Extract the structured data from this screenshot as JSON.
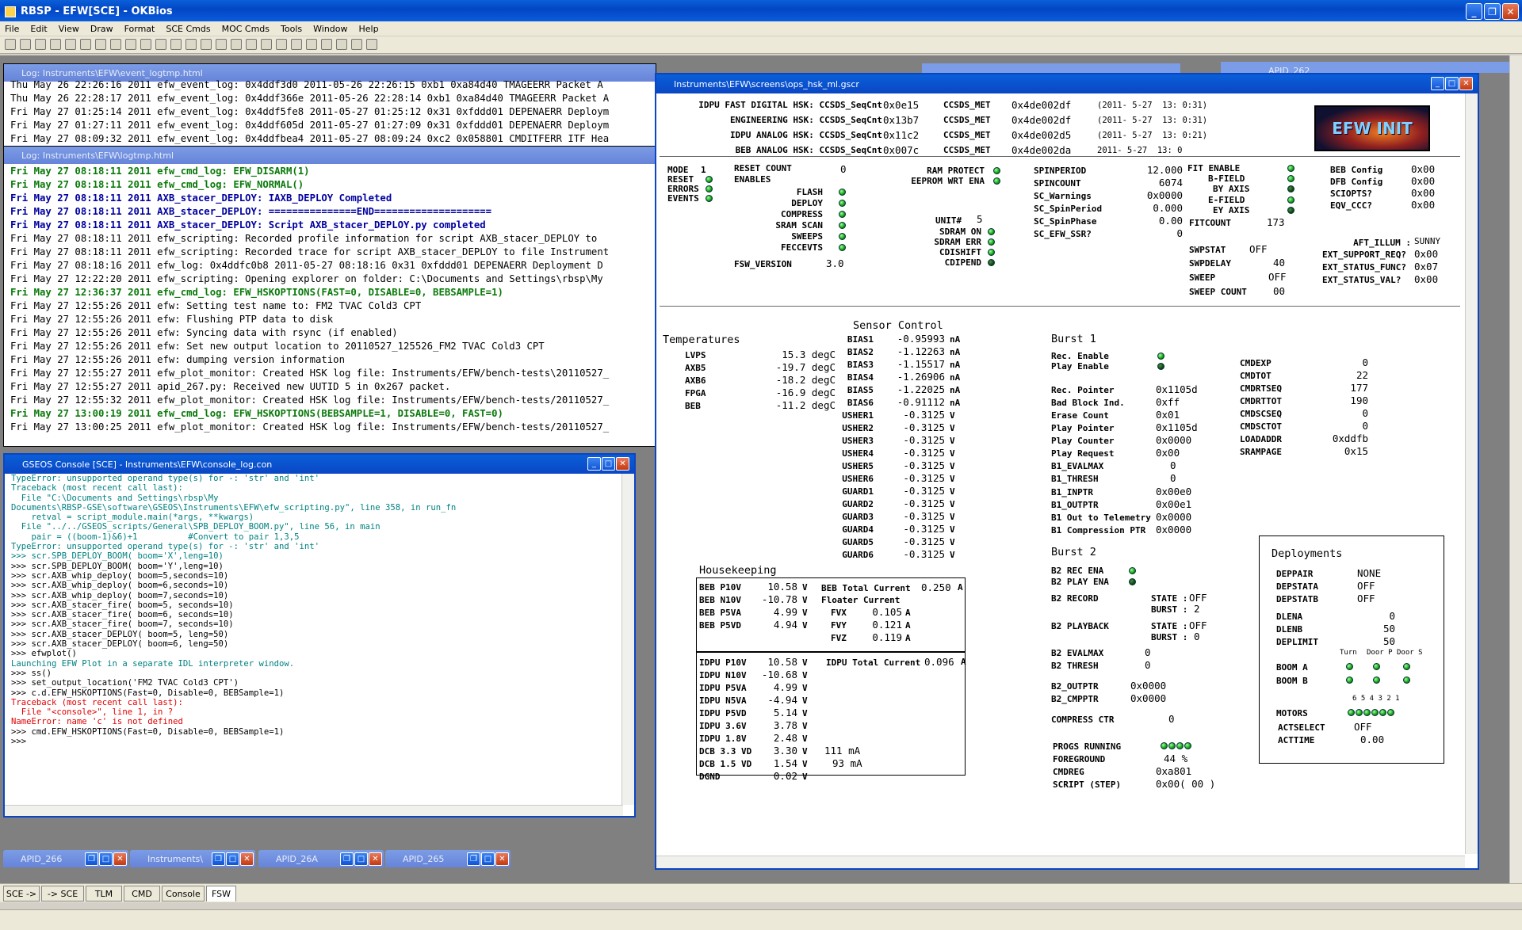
{
  "app": {
    "title": "RBSP - EFW[SCE] - OKBios",
    "menu": [
      "File",
      "Edit",
      "View",
      "Draw",
      "Format",
      "SCE Cmds",
      "MOC Cmds",
      "Tools",
      "Window",
      "Help"
    ]
  },
  "event_log": {
    "title": "Log: Instruments\\EFW\\event_logtmp.html",
    "lines": [
      "Thu May 26 22:26:16 2011 efw_event_log: 0x4ddf3d0 2011-05-26 22:26:15 0xb1 0xa84d40 TMAGEERR Packet A",
      "Thu May 26 22:28:17 2011 efw_event_log: 0x4ddf366e 2011-05-26 22:28:14 0xb1 0xa84d40 TMAGEERR Packet A",
      "Fri May 27 01:25:14 2011 efw_event_log: 0x4ddf5fe8 2011-05-27 01:25:12 0x31 0xfddd01 DEPENAERR Deploym",
      "Fri May 27 01:27:11 2011 efw_event_log: 0x4ddf605d 2011-05-27 01:27:09 0x31 0xfddd01 DEPENAERR Deploym",
      "Fri May 27 08:09:32 2011 efw_event_log: 0x4ddfbea4 2011-05-27 08:09:24 0xc2 0x058801 CMDITFERR ITF Hea"
    ]
  },
  "log": {
    "title": "Log: Instruments\\EFW\\logtmp.html",
    "lines": [
      {
        "t": "Fri May 27 08:18:11 2011 efw_cmd_log: EFW_DISARM(1)",
        "c": "g"
      },
      {
        "t": "Fri May 27 08:18:11 2011 efw_cmd_log: EFW_NORMAL()",
        "c": "g"
      },
      {
        "t": "Fri May 27 08:18:11 2011 AXB_stacer_DEPLOY: IAXB_DEPLOY Completed",
        "c": "b"
      },
      {
        "t": "Fri May 27 08:18:11 2011 AXB_stacer_DEPLOY: ===============END====================",
        "c": "b"
      },
      {
        "t": "Fri May 27 08:18:11 2011 AXB_stacer_DEPLOY: Script AXB_stacer_DEPLOY.py completed",
        "c": "b"
      },
      {
        "t": "Fri May 27 08:18:11 2011 efw_scripting: Recorded profile information for script AXB_stacer_DEPLOY to",
        "c": ""
      },
      {
        "t": "Fri May 27 08:18:11 2011 efw_scripting: Recorded trace for script AXB_stacer_DEPLOY to file Instrument",
        "c": ""
      },
      {
        "t": "Fri May 27 08:18:16 2011 efw_log: 0x4ddfc0b8 2011-05-27 08:18:16 0x31 0xfddd01 DEPENAERR Deployment D",
        "c": ""
      },
      {
        "t": "Fri May 27 12:22:20 2011 efw_scripting: Opening explorer on folder: C:\\Documents and Settings\\rbsp\\My",
        "c": ""
      },
      {
        "t": "Fri May 27 12:36:37 2011 efw_cmd_log: EFW_HSKOPTIONS(FAST=0, DISABLE=0, BEBSAMPLE=1)",
        "c": "g"
      },
      {
        "t": "Fri May 27 12:55:26 2011 efw: Setting test name to: FM2 TVAC Cold3 CPT",
        "c": ""
      },
      {
        "t": "Fri May 27 12:55:26 2011 efw: Flushing PTP data to disk",
        "c": ""
      },
      {
        "t": "Fri May 27 12:55:26 2011 efw: Syncing data with rsync (if enabled)",
        "c": ""
      },
      {
        "t": "Fri May 27 12:55:26 2011 efw: Set new output location to 20110527_125526_FM2 TVAC Cold3 CPT",
        "c": ""
      },
      {
        "t": "Fri May 27 12:55:26 2011 efw: dumping version information",
        "c": ""
      },
      {
        "t": "Fri May 27 12:55:27 2011 efw_plot_monitor: Created HSK log file: Instruments/EFW/bench-tests\\20110527_",
        "c": ""
      },
      {
        "t": "Fri May 27 12:55:27 2011 apid_267.py: Received new UUTID 5 in 0x267 packet.",
        "c": ""
      },
      {
        "t": "Fri May 27 12:55:32 2011 efw_plot_monitor: Created HSK log file: Instruments/EFW/bench-tests/20110527_",
        "c": ""
      },
      {
        "t": "Fri May 27 13:00:19 2011 efw_cmd_log: EFW_HSKOPTIONS(BEBSAMPLE=1, DISABLE=0, FAST=0)",
        "c": "g"
      },
      {
        "t": "Fri May 27 13:00:25 2011 efw_plot_monitor: Created HSK log file: Instruments/EFW/bench-tests/20110527_",
        "c": ""
      }
    ]
  },
  "console": {
    "title": "GSEOS Console  [SCE] - Instruments\\EFW\\console_log.con",
    "lines": [
      {
        "t": "TypeError: unsupported operand type(s) for -: 'str' and 'int'",
        "c": "teal"
      },
      {
        "t": "Traceback (most recent call last):",
        "c": "teal"
      },
      {
        "t": "  File \"C:\\Documents and Settings\\rbsp\\My",
        "c": "teal"
      },
      {
        "t": "Documents\\RBSP-GSE\\software\\GSEOS\\Instruments\\EFW\\efw_scripting.py\", line 358, in run_fn",
        "c": "teal"
      },
      {
        "t": "    retval = script_module.main(*args, **kwargs)",
        "c": "teal"
      },
      {
        "t": "  File \"../../GSEOS_scripts/General\\SPB_DEPLOY_BOOM.py\", line 56, in main",
        "c": "teal"
      },
      {
        "t": "    pair = ((boom-1)&6)+1          #Convert to pair 1,3,5",
        "c": "teal"
      },
      {
        "t": "TypeError: unsupported operand type(s) for -: 'str' and 'int'",
        "c": "teal"
      },
      {
        "t": ">>> scr.SPB_DEPLOY_BOOM( boom='X',leng=10)",
        "c": "teal"
      },
      {
        "t": ">>> scr.SPB_DEPLOY_BOOM( boom='Y',leng=10)",
        "c": ""
      },
      {
        "t": ">>> scr.AXB_whip_deploy( boom=5,seconds=10)",
        "c": ""
      },
      {
        "t": ">>> scr.AXB_whip_deploy( boom=6,seconds=10)",
        "c": ""
      },
      {
        "t": ">>> scr.AXB_whip_deploy( boom=7,seconds=10)",
        "c": ""
      },
      {
        "t": ">>> scr.AXB_stacer_fire( boom=5, seconds=10)",
        "c": ""
      },
      {
        "t": ">>> scr.AXB_stacer_fire( boom=6, seconds=10)",
        "c": ""
      },
      {
        "t": ">>> scr.AXB_stacer_fire( boom=7, seconds=10)",
        "c": ""
      },
      {
        "t": ">>> scr.AXB_stacer_DEPLOY( boom=5, leng=50)",
        "c": ""
      },
      {
        "t": ">>> scr.AXB_stacer_DEPLOY( boom=6, leng=50)",
        "c": ""
      },
      {
        "t": ">>> efwplot()",
        "c": ""
      },
      {
        "t": "Launching EFW Plot in a separate IDL interpreter window.",
        "c": "teal"
      },
      {
        "t": ">>> ss()",
        "c": ""
      },
      {
        "t": ">>> set_output_location('FM2 TVAC Cold3 CPT')",
        "c": ""
      },
      {
        "t": ">>> c.d.EFW_HSKOPTIONS(Fast=0, Disable=0, BEBSample=1)",
        "c": ""
      },
      {
        "t": "Traceback (most recent call last):",
        "c": "red"
      },
      {
        "t": "  File \"<console>\", line 1, in ?",
        "c": "red"
      },
      {
        "t": "NameError: name 'c' is not defined",
        "c": "red"
      },
      {
        "t": ">>> cmd.EFW_HSKOPTIONS(Fast=0, Disable=0, BEBSample=1)",
        "c": ""
      },
      {
        "t": ">>>",
        "c": ""
      }
    ]
  },
  "bg_window": {
    "title": "APID_262"
  },
  "taskbar_windows": [
    "APID_266",
    "Instruments\\",
    "APID_26A",
    "APID_265"
  ],
  "bottom_tabs": [
    "SCE ->",
    "-> SCE",
    "TLM",
    "CMD",
    "Console",
    "FSW"
  ],
  "hsk": {
    "title": "Instruments\\EFW\\screens\\ops_hsk_ml.gscr",
    "logo": "EFW INIT",
    "header": [
      {
        "l": "IDPU FAST DIGITAL HSK: CCSDS_SeqCnt",
        "seq": "0x0e15",
        "met": "0x4de002df",
        "ts": "(2011- 5-27  13: 0:31)"
      },
      {
        "l": "ENGINEERING HSK: CCSDS_SeqCnt",
        "seq": "0x13b7",
        "met": "0x4de002df",
        "ts": "(2011- 5-27  13: 0:31)"
      },
      {
        "l": "IDPU ANALOG HSK: CCSDS_SeqCnt",
        "seq": "0x11c2",
        "met": "0x4de002d5",
        "ts": "(2011- 5-27  13: 0:21)"
      },
      {
        "l": "BEB ANALOG HSK: CCSDS_SeqCnt",
        "seq": "0x007c",
        "met": "0x4de002da",
        "ts": "2011- 5-27  13: 0"
      }
    ],
    "ccsds_met": "CCSDS_MET",
    "mode": {
      "mode_l": "MODE",
      "mode_v": "1",
      "reset": "RESET",
      "errors": "ERRORS",
      "events": "EVENTS"
    },
    "reset_count": {
      "l": "RESET COUNT",
      "v": "0"
    },
    "enables": {
      "l": "ENABLES",
      "items": [
        "FLASH",
        "DEPLOY",
        "COMPRESS",
        "SRAM SCAN",
        "SWEEPS",
        "FECCEVTS"
      ]
    },
    "fsw_version": {
      "l": "FSW_VERSION",
      "v": "3.0"
    },
    "ram": [
      {
        "l": "RAM PROTECT"
      },
      {
        "l": "EEPROM WRT ENA"
      }
    ],
    "unit": {
      "l": "UNIT#",
      "v": "5"
    },
    "sdram": [
      "SDRAM ON",
      "SDRAM ERR",
      "CDISHIFT",
      "CDIPEND"
    ],
    "spin": [
      {
        "l": "SPINPERIOD",
        "v": "12.000"
      },
      {
        "l": "SPINCOUNT",
        "v": "6074"
      },
      {
        "l": "SC_Warnings",
        "v": "0x0000"
      },
      {
        "l": "SC_SpinPeriod",
        "v": "0.000"
      },
      {
        "l": "SC_SpinPhase",
        "v": "0.00"
      },
      {
        "l": "SC_EFW_SSR?",
        "v": "0"
      }
    ],
    "fit": {
      "enable": "FIT ENABLE",
      "bfield": "B-FIELD",
      "byaxis": "BY AXIS",
      "efield": "E-FIELD",
      "eyaxis": "EY AXIS",
      "fitcount_l": "FITCOUNT",
      "fitcount_v": "173"
    },
    "sweep": [
      {
        "l": "SWPSTAT",
        "v": "OFF"
      },
      {
        "l": "SWPDELAY",
        "v": "40"
      },
      {
        "l": "SWEEP",
        "v": "OFF"
      },
      {
        "l": "SWEEP COUNT",
        "v": "00"
      }
    ],
    "config": [
      {
        "l": "BEB Config",
        "v": "0x00"
      },
      {
        "l": "DFB Config",
        "v": "0x00"
      },
      {
        "l": "SCIOPTS?",
        "v": "0x00"
      },
      {
        "l": "EQV_CCC?",
        "v": "0x00"
      }
    ],
    "aft": {
      "l": "AFT_ILLUM :",
      "v": "SUNNY"
    },
    "ext": [
      {
        "l": "EXT_SUPPORT_REQ?",
        "v": "0x00"
      },
      {
        "l": "EXT_STATUS_FUNC?",
        "v": "0x07"
      },
      {
        "l": "EXT_STATUS_VAL?",
        "v": "0x00"
      }
    ],
    "temps": {
      "title": "Temperatures",
      "items": [
        {
          "l": "LVPS",
          "v": "15.3 degC"
        },
        {
          "l": "AXB5",
          "v": "-19.7 degC"
        },
        {
          "l": "AXB6",
          "v": "-18.2 degC"
        },
        {
          "l": "FPGA",
          "v": "-16.9 degC"
        },
        {
          "l": "BEB",
          "v": "-11.2 degC"
        }
      ]
    },
    "sensor": {
      "title": "Sensor Control",
      "items": [
        {
          "l": "BIAS1",
          "v": "-0.95993",
          "u": "nA"
        },
        {
          "l": "BIAS2",
          "v": "-1.12263",
          "u": "nA"
        },
        {
          "l": "BIAS3",
          "v": "-1.15517",
          "u": "nA"
        },
        {
          "l": "BIAS4",
          "v": "-1.26906",
          "u": "nA"
        },
        {
          "l": "BIAS5",
          "v": "-1.22025",
          "u": "nA"
        },
        {
          "l": "BIAS6",
          "v": "-0.91112",
          "u": "nA"
        },
        {
          "l": "USHER1",
          "v": "-0.3125",
          "u": "V"
        },
        {
          "l": "USHER2",
          "v": "-0.3125",
          "u": "V"
        },
        {
          "l": "USHER3",
          "v": "-0.3125",
          "u": "V"
        },
        {
          "l": "USHER4",
          "v": "-0.3125",
          "u": "V"
        },
        {
          "l": "USHER5",
          "v": "-0.3125",
          "u": "V"
        },
        {
          "l": "USHER6",
          "v": "-0.3125",
          "u": "V"
        },
        {
          "l": "GUARD1",
          "v": "-0.3125",
          "u": "V"
        },
        {
          "l": "GUARD2",
          "v": "-0.3125",
          "u": "V"
        },
        {
          "l": "GUARD3",
          "v": "-0.3125",
          "u": "V"
        },
        {
          "l": "GUARD4",
          "v": "-0.3125",
          "u": "V"
        },
        {
          "l": "GUARD5",
          "v": "-0.3125",
          "u": "V"
        },
        {
          "l": "GUARD6",
          "v": "-0.3125",
          "u": "V"
        }
      ]
    },
    "housekeeping": {
      "title": "Housekeeping",
      "beb": [
        {
          "l": "BEB P10V",
          "v": "10.58",
          "u": "V"
        },
        {
          "l": "BEB N10V",
          "v": "-10.78",
          "u": "V"
        },
        {
          "l": "BEB P5VA",
          "v": "4.99",
          "u": "V"
        },
        {
          "l": "BEB P5VD",
          "v": "4.94",
          "u": "V"
        }
      ],
      "beb_total": {
        "l": "BEB Total Current",
        "v": "0.250",
        "u": "A"
      },
      "floater": {
        "l": "Floater Current"
      },
      "fv": [
        {
          "l": "FVX",
          "v": "0.105",
          "u": "A"
        },
        {
          "l": "FVY",
          "v": "0.121",
          "u": "A"
        },
        {
          "l": "FVZ",
          "v": "0.119",
          "u": "A"
        }
      ],
      "idpu": [
        {
          "l": "IDPU P10V",
          "v": "10.58",
          "u": "V"
        },
        {
          "l": "IDPU N10V",
          "v": "-10.68",
          "u": "V"
        },
        {
          "l": "IDPU P5VA",
          "v": "4.99",
          "u": "V"
        },
        {
          "l": "IDPU N5VA",
          "v": "-4.94",
          "u": "V"
        },
        {
          "l": "IDPU P5VD",
          "v": "5.14",
          "u": "V"
        },
        {
          "l": "IDPU 3.6V",
          "v": "3.78",
          "u": "V"
        },
        {
          "l": "IDPU 1.8V",
          "v": "2.48",
          "u": "V"
        },
        {
          "l": "DCB 3.3 VD",
          "v": "3.30",
          "u": "V"
        },
        {
          "l": "DCB 1.5 VD",
          "v": "1.54",
          "u": "V"
        },
        {
          "l": "DGND",
          "v": "0.02",
          "u": "V"
        }
      ],
      "idpu_total": {
        "l": "IDPU Total Current",
        "v": "0.096",
        "u": "A"
      },
      "dcb33_ma": "111 mA",
      "dcb15_ma": "93 mA"
    },
    "burst1": {
      "title": "Burst 1",
      "rec": "Rec. Enable",
      "play": "Play Enable",
      "items": [
        {
          "l": "Rec. Pointer",
          "v": "0x1105d"
        },
        {
          "l": "Bad Block Ind.",
          "v": "0xff"
        },
        {
          "l": "Erase Count",
          "v": "0x01"
        },
        {
          "l": "Play Pointer",
          "v": "0x1105d"
        },
        {
          "l": "Play Counter",
          "v": "0x0000"
        },
        {
          "l": "Play Request",
          "v": "0x00"
        },
        {
          "l": "B1_EVALMAX",
          "v": "0"
        },
        {
          "l": "B1_THRESH",
          "v": "0"
        },
        {
          "l": "B1_INPTR",
          "v": "0x00e0"
        },
        {
          "l": "B1_OUTPTR",
          "v": "0x00e1"
        },
        {
          "l": "B1 Out to Telemetry",
          "v": "0x0000"
        },
        {
          "l": "B1 Compression PTR",
          "v": "0x0000"
        }
      ]
    },
    "cmd": [
      {
        "l": "CMDEXP",
        "v": "0"
      },
      {
        "l": "CMDTOT",
        "v": "22"
      },
      {
        "l": "CMDRTSEQ",
        "v": "177"
      },
      {
        "l": "CMDRTTOT",
        "v": "190"
      },
      {
        "l": "CMDSCSEQ",
        "v": "0"
      },
      {
        "l": "CMDSCTOT",
        "v": "0"
      },
      {
        "l": "LOADADDR",
        "v": "0xddfb"
      },
      {
        "l": "SRAMPAGE",
        "v": "0x15"
      }
    ],
    "burst2": {
      "title": "Burst 2",
      "rec": "B2 REC ENA",
      "play": "B2 PLAY ENA",
      "record": {
        "l": "B2 RECORD",
        "state_l": "STATE :",
        "state_v": "OFF",
        "burst_l": "BURST :",
        "burst_v": "2"
      },
      "playback": {
        "l": "B2 PLAYBACK",
        "state_l": "STATE :",
        "state_v": "OFF",
        "burst_l": "BURST :",
        "burst_v": "0"
      },
      "evalmax": {
        "l": "B2 EVALMAX",
        "v": "0"
      },
      "thresh": {
        "l": "B2 THRESH",
        "v": "0"
      },
      "outptr": {
        "l": "B2_OUTPTR",
        "v": "0x0000"
      },
      "cmpptr": {
        "l": "B2_CMPPTR",
        "v": "0x0000"
      },
      "compress": {
        "l": "COMPRESS CTR",
        "v": "0"
      }
    },
    "progs": {
      "l": "PROGS RUNNING",
      "fg_l": "FOREGROUND",
      "fg_v": "44 %",
      "cmdreg_l": "CMDREG",
      "cmdreg_v": "0xa801",
      "script_l": "SCRIPT (STEP)",
      "script_v": "0x00( 00 )"
    },
    "deploy": {
      "title": "Deployments",
      "items": [
        {
          "l": "DEPPAIR",
          "v": "NONE"
        },
        {
          "l": "DEPSTATA",
          "v": "OFF"
        },
        {
          "l": "DEPSTATB",
          "v": "OFF"
        }
      ],
      "items2": [
        {
          "l": "DLENA",
          "v": "0"
        },
        {
          "l": "DLENB",
          "v": "50"
        },
        {
          "l": "DEPLIMIT",
          "v": "50"
        }
      ],
      "cols": [
        "Turn",
        "Door P",
        "Door S"
      ],
      "boom_a": "BOOM A",
      "boom_b": "BOOM B",
      "motors_nums": "6 5 4 3 2 1",
      "motors": "MOTORS",
      "actselect": {
        "l": "ACTSELECT",
        "v": "OFF"
      },
      "acttime": {
        "l": "ACTTIME",
        "v": "0.00"
      }
    }
  }
}
